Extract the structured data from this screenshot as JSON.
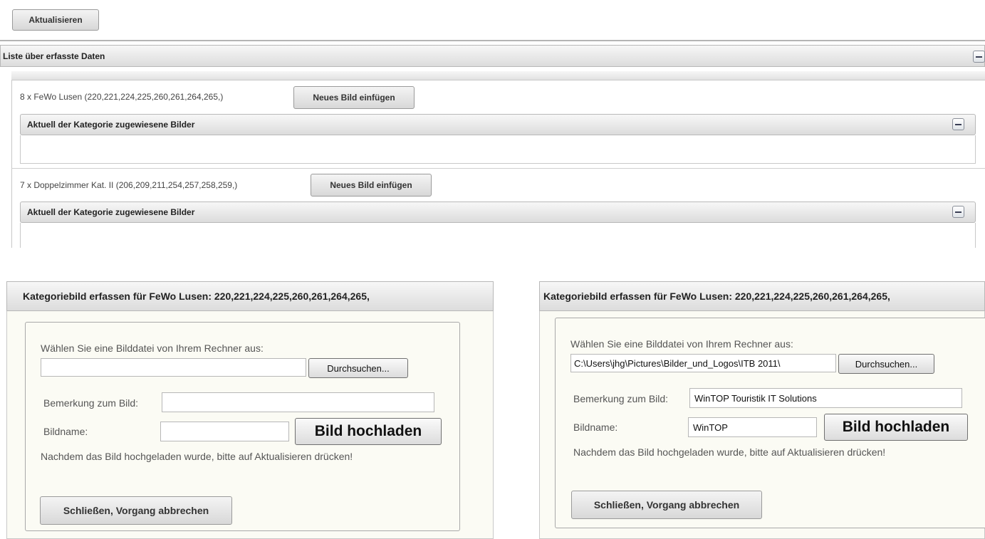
{
  "toolbar": {
    "refresh_label": "Aktualisieren"
  },
  "list_panel": {
    "title": "Liste über erfasste Daten",
    "categories": [
      {
        "text": "8 x FeWo Lusen (220,221,224,225,260,261,264,265,)",
        "insert_label": "Neues Bild einfügen",
        "images_header": "Aktuell der Kategorie zugewiesene Bilder"
      },
      {
        "text": "7 x Doppelzimmer Kat. II (206,209,211,254,257,258,259,)",
        "insert_label": "Neues Bild einfügen",
        "images_header": "Aktuell der Kategorie zugewiesene Bilder"
      }
    ]
  },
  "dialogs": [
    {
      "title": "Kategoriebild erfassen für FeWo Lusen: 220,221,224,225,260,261,264,265,",
      "choose_label": "Wählen Sie eine Bilddatei von Ihrem Rechner aus:",
      "file_value": "",
      "browse_label": "Durchsuchen...",
      "remark_label": "Bemerkung zum Bild:",
      "remark_value": "",
      "name_label": "Bildname:",
      "name_value": "",
      "upload_label": "Bild hochladen",
      "hint": "Nachdem das Bild hochgeladen wurde, bitte auf Aktualisieren drücken!",
      "close_label": "Schließen, Vorgang abbrechen"
    },
    {
      "title": "Kategoriebild erfassen für FeWo Lusen: 220,221,224,225,260,261,264,265,",
      "choose_label": "Wählen Sie eine Bilddatei von Ihrem Rechner aus:",
      "file_value": "C:\\Users\\jhg\\Pictures\\Bilder_und_Logos\\ITB 2011\\",
      "browse_label": "Durchsuchen...",
      "remark_label": "Bemerkung zum Bild:",
      "remark_value": "WinTOP Touristik IT Solutions",
      "name_label": "Bildname:",
      "name_value": "WinTOP",
      "upload_label": "Bild hochladen",
      "hint": "Nachdem das Bild hochgeladen wurde, bitte auf Aktualisieren drücken!",
      "close_label": "Schließen, Vorgang abbrechen"
    }
  ]
}
